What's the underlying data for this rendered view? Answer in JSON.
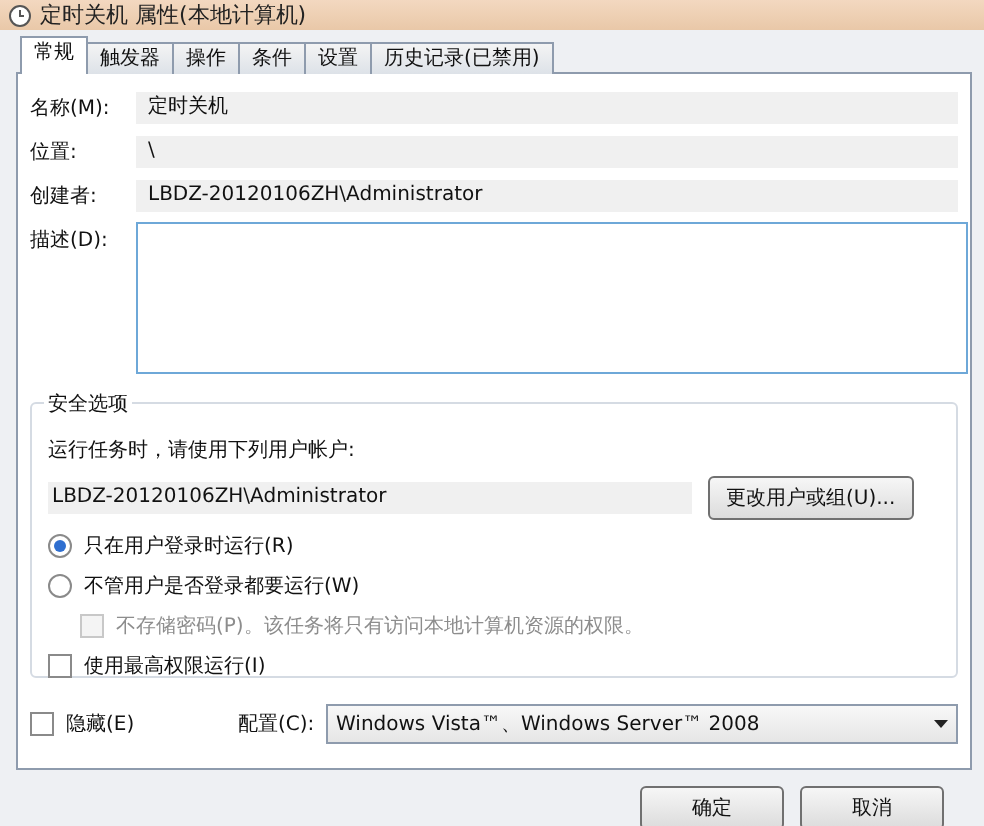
{
  "window": {
    "title": "定时关机 属性(本地计算机)"
  },
  "tabs": [
    {
      "label": "常规",
      "selected": true
    },
    {
      "label": "触发器",
      "selected": false
    },
    {
      "label": "操作",
      "selected": false
    },
    {
      "label": "条件",
      "selected": false
    },
    {
      "label": "设置",
      "selected": false
    },
    {
      "label": "历史记录(已禁用)",
      "selected": false
    }
  ],
  "general": {
    "name_label": "名称(M):",
    "name_value": "定时关机",
    "location_label": "位置:",
    "location_value": "\\",
    "author_label": "创建者:",
    "author_value": "LBDZ-20120106ZH\\Administrator",
    "description_label": "描述(D):"
  },
  "security": {
    "title": "安全选项",
    "account_prompt": "运行任务时，请使用下列用户帐户:",
    "account_value": "LBDZ-20120106ZH\\Administrator",
    "change_button": "更改用户或组(U)...",
    "radios": [
      {
        "label": "只在用户登录时运行(R)",
        "selected": true
      },
      {
        "label": "不管用户是否登录都要运行(W)",
        "selected": false
      }
    ],
    "no_password": {
      "label": "不存储密码(P)。该任务将只有访问本地计算机资源的权限。",
      "checked": false,
      "disabled": true
    },
    "highest": {
      "label": "使用最高权限运行(I)",
      "checked": false
    }
  },
  "hidden": {
    "label": "隐藏(E)",
    "checked": false
  },
  "config": {
    "label": "配置(C):",
    "value": "Windows Vista™、Windows Server™ 2008"
  },
  "buttons": [
    "确定",
    "取消"
  ]
}
